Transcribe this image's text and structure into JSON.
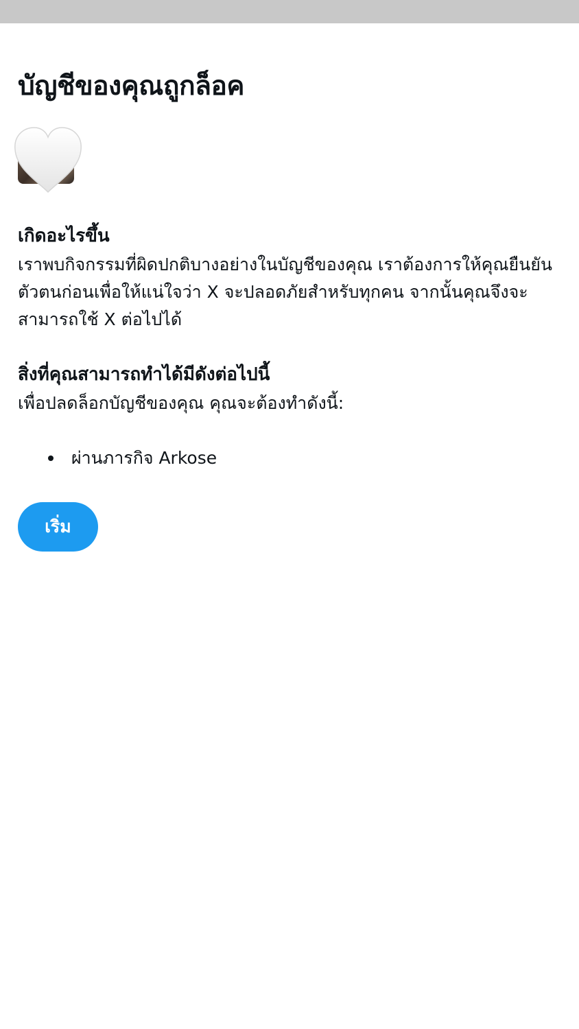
{
  "page": {
    "title": "บัญชีของคุณถูกล็อค"
  },
  "what_happened": {
    "heading": "เกิดอะไรขึ้น",
    "text": "เราพบกิจกรรมที่ผิดปกติบางอย่างในบัญชีของคุณ เราต้องการให้คุณยืนยันตัวตนก่อนเพื่อให้แน่ใจว่า X จะปลอดภัยสำหรับทุกคน จากนั้นคุณจึงจะสามารถใช้ X ต่อไปได้"
  },
  "what_you_can_do": {
    "heading": "สิ่งที่คุณสามารถทำได้มีดังต่อไปนี้",
    "text": "เพื่อปลดล็อกบัญชีของคุณ คุณจะต้องทำดังนี้:",
    "tasks": [
      {
        "label": "ผ่านภารกิจ Arkose"
      }
    ]
  },
  "actions": {
    "start_label": "เริ่ม"
  },
  "colors": {
    "accent": "#1d9bf0",
    "top_bar": "#c8c8c8",
    "text": "#0f1419"
  }
}
